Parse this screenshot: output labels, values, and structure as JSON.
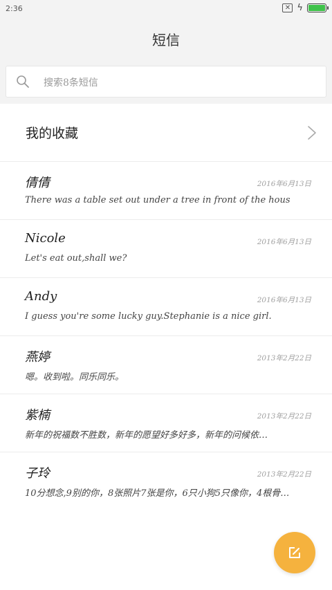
{
  "status_bar": {
    "time": "2:36",
    "sim_icon": "sim-off-icon",
    "charging_icon": "bolt-icon",
    "battery_icon": "battery-icon",
    "battery_color": "#3fc24a",
    "battery_level": 1.0
  },
  "header": {
    "title": "短信"
  },
  "search": {
    "icon": "search-icon",
    "placeholder": "搜索8条短信"
  },
  "favorites": {
    "label": "我的收藏",
    "icon": "chevron-right-icon"
  },
  "messages": [
    {
      "name": "倩倩",
      "date": "2016年6月13日",
      "preview": "There was a table set out under a tree in front of the hous"
    },
    {
      "name": "Nicole",
      "date": "2016年6月13日",
      "preview": "Let's eat out,shall we?"
    },
    {
      "name": "Andy",
      "date": "2016年6月13日",
      "preview": "I guess you're some lucky guy.Stephanie is a nice girl."
    },
    {
      "name": "燕婷",
      "date": "2013年2月22日",
      "preview": "嗯。收到啦。同乐同乐。"
    },
    {
      "name": "紫楠",
      "date": "2013年2月22日",
      "preview": "新年的祝福数不胜数，新年的愿望好多好多，新年的问候依…"
    },
    {
      "name": "子玲",
      "date": "2013年2月22日",
      "preview": "10分想念,9别的你，8张照片7张是你，6只小狗5只像你，4根骨…"
    }
  ],
  "fab": {
    "icon": "compose-icon",
    "color": "#f5b23e"
  },
  "colors": {
    "header_bg": "#f3f3f3",
    "accent": "#f5b23e"
  }
}
